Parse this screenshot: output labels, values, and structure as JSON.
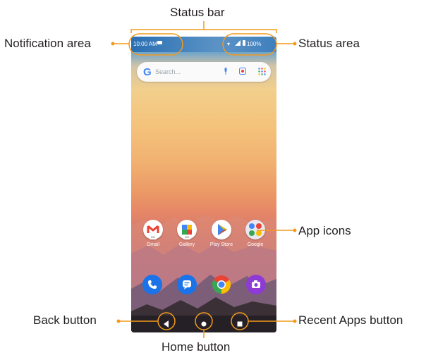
{
  "labels": {
    "status_bar": "Status bar",
    "notification_area": "Notification area",
    "status_area": "Status area",
    "app_icons": "App icons",
    "back_button": "Back button",
    "home_button": "Home button",
    "recent_apps_button": "Recent Apps button"
  },
  "phone": {
    "status": {
      "time": "10:00 AM",
      "battery": "100%"
    },
    "search": {
      "placeholder": "Search..."
    },
    "apps": [
      {
        "label": "Gmail",
        "icon": "gmail-icon"
      },
      {
        "label": "Gallery",
        "icon": "gallery-icon"
      },
      {
        "label": "Play Store",
        "icon": "play-store-icon"
      },
      {
        "label": "Google",
        "icon": "google-folder-icon"
      }
    ],
    "dock": [
      "phone-icon",
      "messages-icon",
      "chrome-icon",
      "camera-icon"
    ],
    "go_badge": "GO"
  },
  "colors": {
    "callout": "#f39a1c"
  }
}
